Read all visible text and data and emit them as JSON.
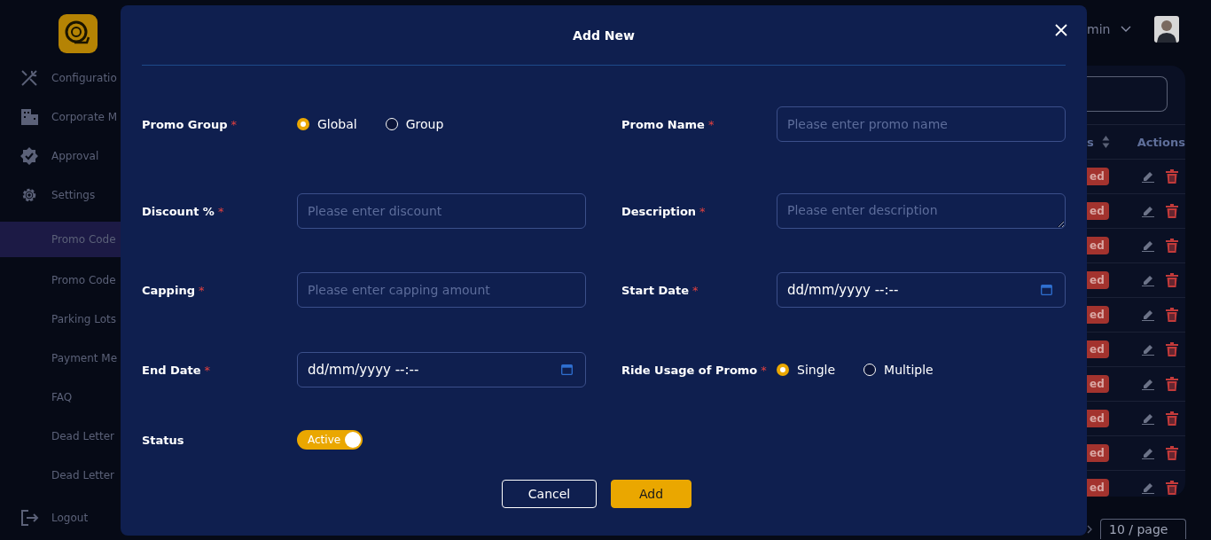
{
  "sidebar": {
    "items": [
      {
        "label": "Configuratio",
        "kind": "tools",
        "selected": false
      },
      {
        "label": "Corporate M",
        "kind": "building",
        "selected": false
      },
      {
        "label": "Approval",
        "kind": "verified",
        "selected": false
      },
      {
        "label": "Settings",
        "kind": "gear",
        "selected": false
      },
      {
        "label": "Promo Code",
        "kind": "sub",
        "selected": true
      },
      {
        "label": "Promo Code",
        "kind": "sub",
        "selected": false
      },
      {
        "label": "Parking Lots",
        "kind": "sub",
        "selected": false
      },
      {
        "label": "Payment Me",
        "kind": "sub",
        "selected": false
      },
      {
        "label": "FAQ",
        "kind": "sub",
        "selected": false
      },
      {
        "label": "Dead Letter",
        "kind": "sub",
        "selected": false
      },
      {
        "label": "Dead Letter",
        "kind": "sub",
        "selected": false
      },
      {
        "label": "Logout",
        "kind": "logout",
        "selected": false
      }
    ]
  },
  "header": {
    "user_name": "min"
  },
  "table": {
    "columns": [
      "s",
      "Actions"
    ],
    "rows": [
      {
        "status": "ed"
      },
      {
        "status": "ed"
      },
      {
        "status": "ed"
      },
      {
        "status": "ed"
      },
      {
        "status": "ed"
      },
      {
        "status": "ed"
      },
      {
        "status": "ed"
      },
      {
        "status": "ed"
      },
      {
        "status": "ed"
      },
      {
        "status": "ed"
      }
    ]
  },
  "pagination": {
    "page_size": "10 / page"
  },
  "modal": {
    "title": "Add New",
    "fields": [
      {
        "label": "Promo Group",
        "required_mark": "*",
        "kind": "radio",
        "options": [
          {
            "label": "Global",
            "selected": true
          },
          {
            "label": "Group",
            "selected": false
          }
        ]
      },
      {
        "label": "Promo Name",
        "required_mark": "*",
        "kind": "text",
        "placeholder": "Please enter promo name"
      },
      {
        "label": "Discount %",
        "required_mark": "*",
        "kind": "text",
        "placeholder": "Please enter discount"
      },
      {
        "label": "Description",
        "required_mark": "*",
        "kind": "textarea",
        "placeholder": "Please enter description"
      },
      {
        "label": "Capping",
        "required_mark": "*",
        "kind": "text",
        "placeholder": "Please enter capping amount"
      },
      {
        "label": "Start Date",
        "required_mark": "*",
        "kind": "datetime",
        "value": "dd/mm/yyyy --:--"
      },
      {
        "label": "End Date",
        "required_mark": "*",
        "kind": "datetime",
        "value": "dd/mm/yyyy --:--"
      },
      {
        "label": "Ride Usage of Promo",
        "required_mark": "*",
        "kind": "radio",
        "options": [
          {
            "label": "Single",
            "selected": true
          },
          {
            "label": "Multiple",
            "selected": false
          }
        ]
      },
      {
        "label": "Status",
        "kind": "switch",
        "on": true,
        "text": "Active"
      }
    ],
    "buttons": [
      {
        "label": "Cancel",
        "kind": "secondary"
      },
      {
        "label": "Add",
        "kind": "primary"
      }
    ]
  }
}
